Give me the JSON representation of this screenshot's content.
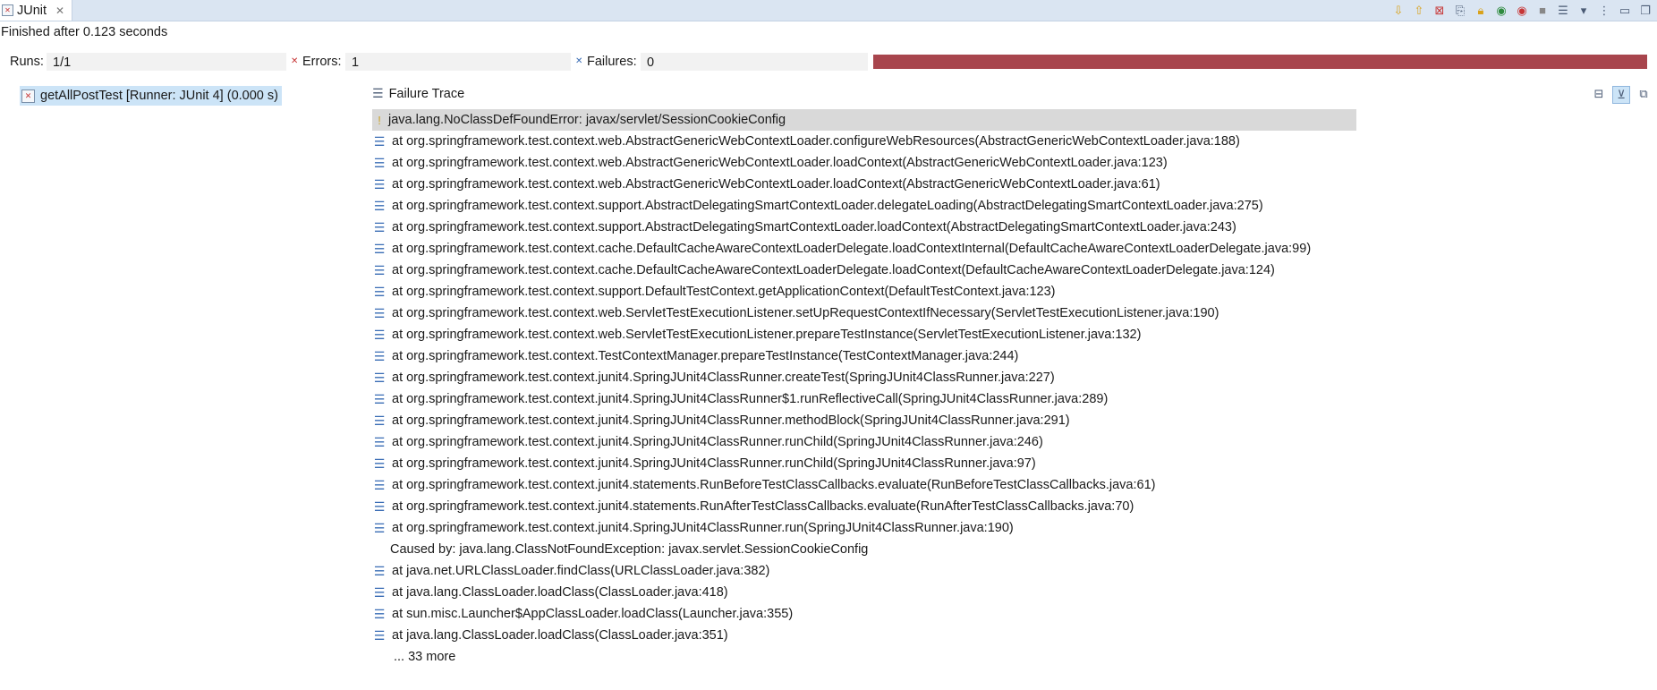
{
  "tab": {
    "title": "JUnit",
    "close": "✕"
  },
  "status": "Finished after 0.123 seconds",
  "counters": {
    "runs_label": "Runs:",
    "runs_value": "1/1",
    "errors_label": "Errors:",
    "errors_value": "1",
    "failures_label": "Failures:",
    "failures_value": "0"
  },
  "progress": {
    "fraction": 1.0,
    "color": "#a8454d"
  },
  "tree": {
    "item_label": "getAllPostTest [Runner: JUnit 4] (0.000 s)"
  },
  "trace": {
    "header": "Failure Trace",
    "exception": "java.lang.NoClassDefFoundError: javax/servlet/SessionCookieConfig",
    "frames": [
      "at org.springframework.test.context.web.AbstractGenericWebContextLoader.configureWebResources(AbstractGenericWebContextLoader.java:188)",
      "at org.springframework.test.context.web.AbstractGenericWebContextLoader.loadContext(AbstractGenericWebContextLoader.java:123)",
      "at org.springframework.test.context.web.AbstractGenericWebContextLoader.loadContext(AbstractGenericWebContextLoader.java:61)",
      "at org.springframework.test.context.support.AbstractDelegatingSmartContextLoader.delegateLoading(AbstractDelegatingSmartContextLoader.java:275)",
      "at org.springframework.test.context.support.AbstractDelegatingSmartContextLoader.loadContext(AbstractDelegatingSmartContextLoader.java:243)",
      "at org.springframework.test.context.cache.DefaultCacheAwareContextLoaderDelegate.loadContextInternal(DefaultCacheAwareContextLoaderDelegate.java:99)",
      "at org.springframework.test.context.cache.DefaultCacheAwareContextLoaderDelegate.loadContext(DefaultCacheAwareContextLoaderDelegate.java:124)",
      "at org.springframework.test.context.support.DefaultTestContext.getApplicationContext(DefaultTestContext.java:123)",
      "at org.springframework.test.context.web.ServletTestExecutionListener.setUpRequestContextIfNecessary(ServletTestExecutionListener.java:190)",
      "at org.springframework.test.context.web.ServletTestExecutionListener.prepareTestInstance(ServletTestExecutionListener.java:132)",
      "at org.springframework.test.context.TestContextManager.prepareTestInstance(TestContextManager.java:244)",
      "at org.springframework.test.context.junit4.SpringJUnit4ClassRunner.createTest(SpringJUnit4ClassRunner.java:227)",
      "at org.springframework.test.context.junit4.SpringJUnit4ClassRunner$1.runReflectiveCall(SpringJUnit4ClassRunner.java:289)",
      "at org.springframework.test.context.junit4.SpringJUnit4ClassRunner.methodBlock(SpringJUnit4ClassRunner.java:291)",
      "at org.springframework.test.context.junit4.SpringJUnit4ClassRunner.runChild(SpringJUnit4ClassRunner.java:246)",
      "at org.springframework.test.context.junit4.SpringJUnit4ClassRunner.runChild(SpringJUnit4ClassRunner.java:97)",
      "at org.springframework.test.context.junit4.statements.RunBeforeTestClassCallbacks.evaluate(RunBeforeTestClassCallbacks.java:61)",
      "at org.springframework.test.context.junit4.statements.RunAfterTestClassCallbacks.evaluate(RunAfterTestClassCallbacks.java:70)",
      "at org.springframework.test.context.junit4.SpringJUnit4ClassRunner.run(SpringJUnit4ClassRunner.java:190)"
    ],
    "caused_by": "Caused by: java.lang.ClassNotFoundException: javax.servlet.SessionCookieConfig",
    "cause_frames": [
      "at java.net.URLClassLoader.findClass(URLClassLoader.java:382)",
      "at java.lang.ClassLoader.loadClass(ClassLoader.java:418)",
      "at sun.misc.Launcher$AppClassLoader.loadClass(Launcher.java:355)",
      "at java.lang.ClassLoader.loadClass(ClassLoader.java:351)"
    ],
    "more": "... 33 more"
  }
}
